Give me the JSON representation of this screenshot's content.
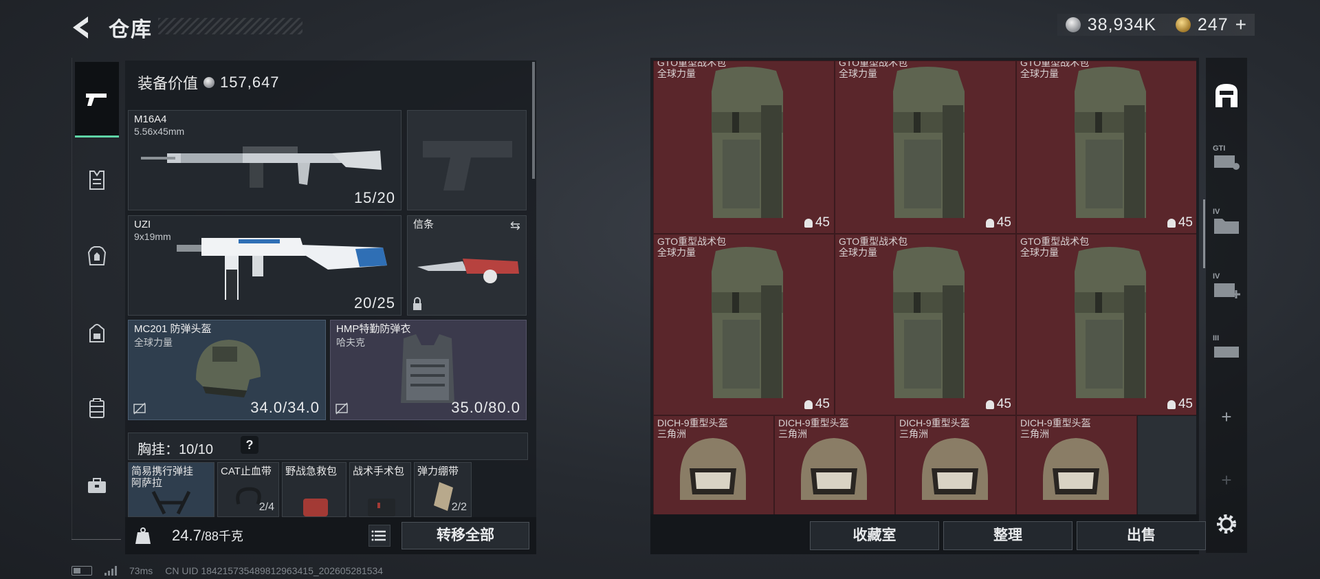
{
  "header": {
    "title": "仓库",
    "currency": {
      "silver_value": "38,934K",
      "gold_value": "247",
      "gold_plus": "+"
    }
  },
  "left_nav": {
    "items": [
      {
        "name": "weapons",
        "icon": "pistol-icon",
        "active": true
      },
      {
        "name": "chest-rig",
        "icon": "vest-icon"
      },
      {
        "name": "armor",
        "icon": "armor-icon"
      },
      {
        "name": "backpack",
        "icon": "backpack-icon"
      },
      {
        "name": "container",
        "icon": "case-icon"
      },
      {
        "name": "toolbox",
        "icon": "toolbox-icon"
      }
    ]
  },
  "equipment": {
    "value_label": "装备价值",
    "value": "157,647",
    "primary_weapon": {
      "name": "M16A4",
      "caliber": "5.56x45mm",
      "ammo": "15/20"
    },
    "secondary_weapon": {
      "name": "UZI",
      "caliber": "9x19mm",
      "ammo": "20/25"
    },
    "melee": {
      "name": "信条"
    },
    "helmet": {
      "name": "MC201 防弹头盔",
      "faction": "全球力量",
      "durability": "34.0/34.0"
    },
    "armor": {
      "name": "HMP特勤防弹衣",
      "faction": "哈夫克",
      "durability": "35.0/80.0"
    },
    "chest_rig": {
      "label": "胸挂",
      "capacity": "10/10",
      "help": "?"
    },
    "chest_items": [
      {
        "label": "简易携行弹挂\n阿萨拉",
        "count": ""
      },
      {
        "label": "CAT止血带",
        "count": "2/4"
      },
      {
        "label": "野战急救包",
        "count": ""
      },
      {
        "label": "战术手术包",
        "count": ""
      },
      {
        "label": "弹力绷带",
        "count": "2/2"
      }
    ],
    "weight": {
      "current": "24.7",
      "max": "/88千克"
    },
    "transfer_all": "转移全部"
  },
  "storage": {
    "rows": [
      {
        "items": [
          {
            "name": "GTO重型战术包",
            "faction": "全球力量",
            "capacity": "45"
          },
          {
            "name": "GTO重型战术包",
            "faction": "全球力量",
            "capacity": "45"
          },
          {
            "name": "GTO重型战术包",
            "faction": "全球力量",
            "capacity": "45"
          }
        ]
      },
      {
        "items": [
          {
            "name": "GTO重型战术包",
            "faction": "全球力量",
            "capacity": "45"
          },
          {
            "name": "GTO重型战术包",
            "faction": "全球力量",
            "capacity": "45"
          },
          {
            "name": "GTO重型战术包",
            "faction": "全球力量",
            "capacity": "45"
          }
        ]
      },
      {
        "items": [
          {
            "name": "DICH-9重型头盔",
            "faction": "三角洲"
          },
          {
            "name": "DICH-9重型头盔",
            "faction": "三角洲"
          },
          {
            "name": "DICH-9重型头盔",
            "faction": "三角洲"
          },
          {
            "name": "DICH-9重型头盔",
            "faction": "三角洲"
          }
        ]
      }
    ],
    "buttons": {
      "collection": "收藏室",
      "organize": "整理",
      "sell": "出售"
    }
  },
  "right_tabs": [
    {
      "icon": "storage-home-icon",
      "label": ""
    },
    {
      "icon": "gti-expansion-icon",
      "label": "GTI"
    },
    {
      "icon": "folder-iv-icon",
      "label": "IV"
    },
    {
      "icon": "medkit-iv-icon",
      "label": "IV"
    },
    {
      "icon": "ammo-iii-icon",
      "label": "III"
    },
    {
      "icon": "add-icon",
      "label": "+"
    },
    {
      "icon": "add-icon",
      "label": "+"
    }
  ],
  "footer": {
    "ping": "73ms",
    "uid": "CN UID 18421573548981296341​5_202605281534"
  },
  "colors": {
    "accent": "#5fd4a6",
    "storage_cell": "#5a262b",
    "blue_slot": "#2f3e4e",
    "purple_slot": "#3b3a4c"
  }
}
